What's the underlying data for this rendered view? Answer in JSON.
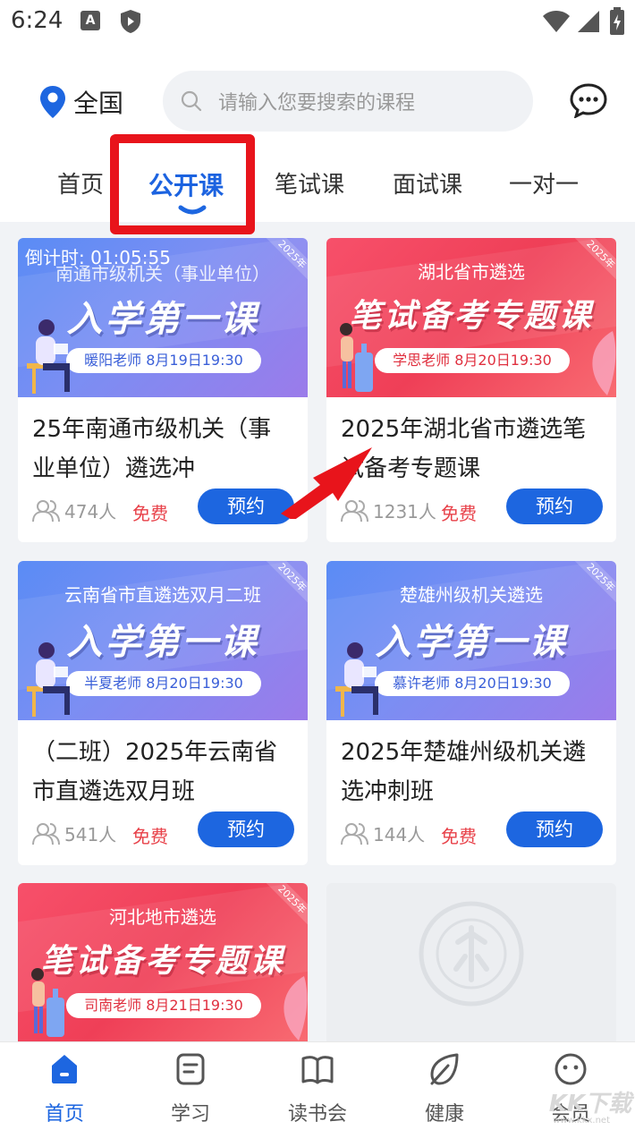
{
  "status_bar": {
    "time": "6:24",
    "a_badge": "A"
  },
  "header": {
    "location": "全国",
    "search_placeholder": "请输入您要搜索的课程",
    "tabs": [
      {
        "label": "首页",
        "active": false
      },
      {
        "label": "公开课",
        "active": true
      },
      {
        "label": "笔试课",
        "active": false
      },
      {
        "label": "面试课",
        "active": false
      },
      {
        "label": "一对一",
        "active": false
      }
    ]
  },
  "colors": {
    "accent": "#1d66e0",
    "free_red": "#e8424a",
    "highlight_red": "#e8141b"
  },
  "courses": [
    {
      "banner_style": "blue",
      "countdown": "倒计时:  01:05:55",
      "banner_sub": "南通市级机关（事业单位）",
      "banner_big": "入学第一课",
      "banner_teacher": "暖阳老师  8月19日19:30",
      "year_tag": "2025年",
      "title": "25年南通市级机关（事业单位）遴选冲",
      "people": "474人",
      "price": "免费",
      "button": "预约"
    },
    {
      "banner_style": "red",
      "countdown": "",
      "banner_sub": "湖北省市遴选",
      "banner_big": "笔试备考专题课",
      "banner_teacher": "学思老师  8月20日19:30",
      "year_tag": "2025年",
      "title": "2025年湖北省市遴选笔试备考专题课",
      "people": "1231人",
      "price": "免费",
      "button": "预约"
    },
    {
      "banner_style": "blue",
      "countdown": "",
      "banner_sub": "云南省市直遴选双月二班",
      "banner_big": "入学第一课",
      "banner_teacher": "半夏老师  8月20日19:30",
      "year_tag": "2025年",
      "title": "（二班）2025年云南省市直遴选双月班",
      "people": "541人",
      "price": "免费",
      "button": "预约"
    },
    {
      "banner_style": "blue",
      "countdown": "",
      "banner_sub": "楚雄州级机关遴选",
      "banner_big": "入学第一课",
      "banner_teacher": "慕许老师  8月20日19:30",
      "year_tag": "2025年",
      "title": "2025年楚雄州级机关遴选冲刺班",
      "people": "144人",
      "price": "免费",
      "button": "预约"
    },
    {
      "banner_style": "red",
      "countdown": "",
      "banner_sub": "河北地市遴选",
      "banner_big": "笔试备考专题课",
      "banner_teacher": "司南老师  8月21日19:30",
      "year_tag": "2025年"
    }
  ],
  "bottom_nav": [
    {
      "label": "首页",
      "icon": "home-icon",
      "active": true
    },
    {
      "label": "学习",
      "icon": "study-icon",
      "active": false
    },
    {
      "label": "读书会",
      "icon": "book-icon",
      "active": false
    },
    {
      "label": "健康",
      "icon": "leaf-icon",
      "active": false
    },
    {
      "label": "会员",
      "icon": "member-icon",
      "active": false
    }
  ],
  "watermark": {
    "text": "KK下载",
    "sub": "www.kkx.net"
  }
}
